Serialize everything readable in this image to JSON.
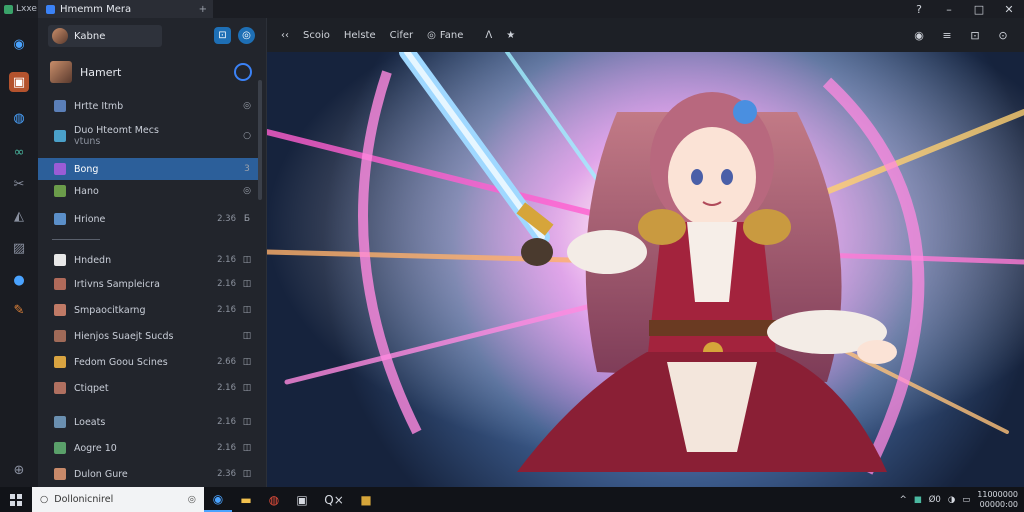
{
  "titlebar": {
    "app_label": "Lxxe",
    "tab_title": "Hmemm Mera",
    "tab_close": "+"
  },
  "sidebar": {
    "account_name": "Kabne",
    "profile_name": "Hamert",
    "items": [
      {
        "label": "Hrtte Itmb",
        "meta": "",
        "mark": "◎",
        "color": "#5b7fb8"
      },
      {
        "label": "Duo Hteomt Mecs",
        "label2": "vtuns",
        "meta": "",
        "mark": "○",
        "color": "#4aa0c9"
      },
      {
        "label": "Bong",
        "meta": "",
        "mark": "3",
        "color": "#9a5cd6"
      },
      {
        "label": "Hano",
        "meta": "",
        "mark": "◎",
        "color": "#6b9c4a"
      },
      {
        "label": "Hrione",
        "meta": "2.36",
        "mark": "Б",
        "color": "#5b8fc9"
      },
      {
        "label": "Hndedn",
        "meta": "2.16",
        "mark": "◫",
        "color": "#e8e8e8"
      },
      {
        "label": "Irtivns Sampleicra",
        "meta": "2.16",
        "mark": "◫",
        "color": "#b06a5a"
      },
      {
        "label": "Smpaocitkarng",
        "meta": "2.16",
        "mark": "◫",
        "color": "#c07a66"
      },
      {
        "label": "Hienjos Suaejt Sucds",
        "meta": "",
        "mark": "◫",
        "color": "#a06a58"
      },
      {
        "label": "Fedom Goou Scines",
        "meta": "2.66",
        "mark": "◫",
        "color": "#d9a441"
      },
      {
        "label": "Ctiqpet",
        "meta": "2.16",
        "mark": "◫",
        "color": "#b07060"
      },
      {
        "label": "Loeats",
        "meta": "2.16",
        "mark": "◫",
        "color": "#6a8fb0"
      },
      {
        "label": "Aogre 10",
        "meta": "2.16",
        "mark": "◫",
        "color": "#5aa06a"
      },
      {
        "label": "Dulon Gure",
        "meta": "2.36",
        "mark": "◫",
        "color": "#c98a6a"
      }
    ]
  },
  "toolbar": {
    "back": "‹‹",
    "items": [
      "Scoio",
      "Helste",
      "Cifer",
      "Fane"
    ],
    "fane_icon": "◎",
    "chevron": "ᐱ",
    "star": "★",
    "right_icons": [
      "◉",
      "≡",
      "⊡",
      "⊙"
    ]
  },
  "taskbar": {
    "search_text": "Dollonicnirel",
    "mic": "◎",
    "app_label": "Q×",
    "time": "11000000",
    "date": "00000:00",
    "tray_text": "Ø0"
  },
  "colors": {
    "accent": "#2c5f9a",
    "rail_active": "#b4532e",
    "blue": "#3b82f6"
  }
}
